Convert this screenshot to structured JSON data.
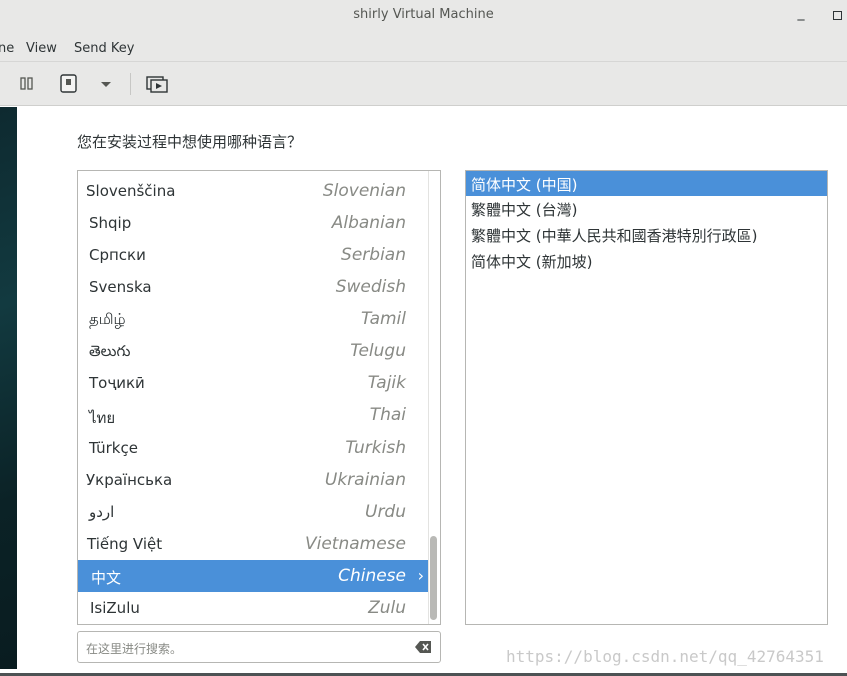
{
  "window": {
    "title": "shirly Virtual Machine",
    "minimize": "_"
  },
  "menu": [
    "ne",
    "View",
    "Send Key"
  ],
  "installer": {
    "question": "您在安装过程中想使用哪种语言？",
    "languages": [
      {
        "native": "Slovenščina",
        "english": "Slovenian"
      },
      {
        "native": "Shqip",
        "english": "Albanian"
      },
      {
        "native": "Српски",
        "english": "Serbian"
      },
      {
        "native": "Svenska",
        "english": "Swedish"
      },
      {
        "native": "தமிழ்",
        "english": "Tamil"
      },
      {
        "native": "తెలుగు",
        "english": "Telugu"
      },
      {
        "native": "Тоҷикӣ",
        "english": "Tajik"
      },
      {
        "native": "ไทย",
        "english": "Thai"
      },
      {
        "native": "Türkçe",
        "english": "Turkish"
      },
      {
        "native": "Українська",
        "english": "Ukrainian"
      },
      {
        "native": "اردو",
        "english": "Urdu"
      },
      {
        "native": "Tiếng Việt",
        "english": "Vietnamese"
      },
      {
        "native": "中文",
        "english": "Chinese",
        "selected": true
      },
      {
        "native": "IsiZulu",
        "english": "Zulu"
      }
    ],
    "locales": [
      {
        "label": "简体中文 (中国)",
        "selected": true
      },
      {
        "label": "繁體中文 (台灣)"
      },
      {
        "label": "繁體中文 (中華人民共和國香港特別行政區)"
      },
      {
        "label": "简体中文 (新加坡)"
      }
    ],
    "search_placeholder": "在这里进行搜索。",
    "scroll_position": 0.8
  },
  "watermark": "https://blog.csdn.net/qq_42764351",
  "colors": {
    "selection": "#4a90d9",
    "chrome": "#e8e8e7"
  }
}
